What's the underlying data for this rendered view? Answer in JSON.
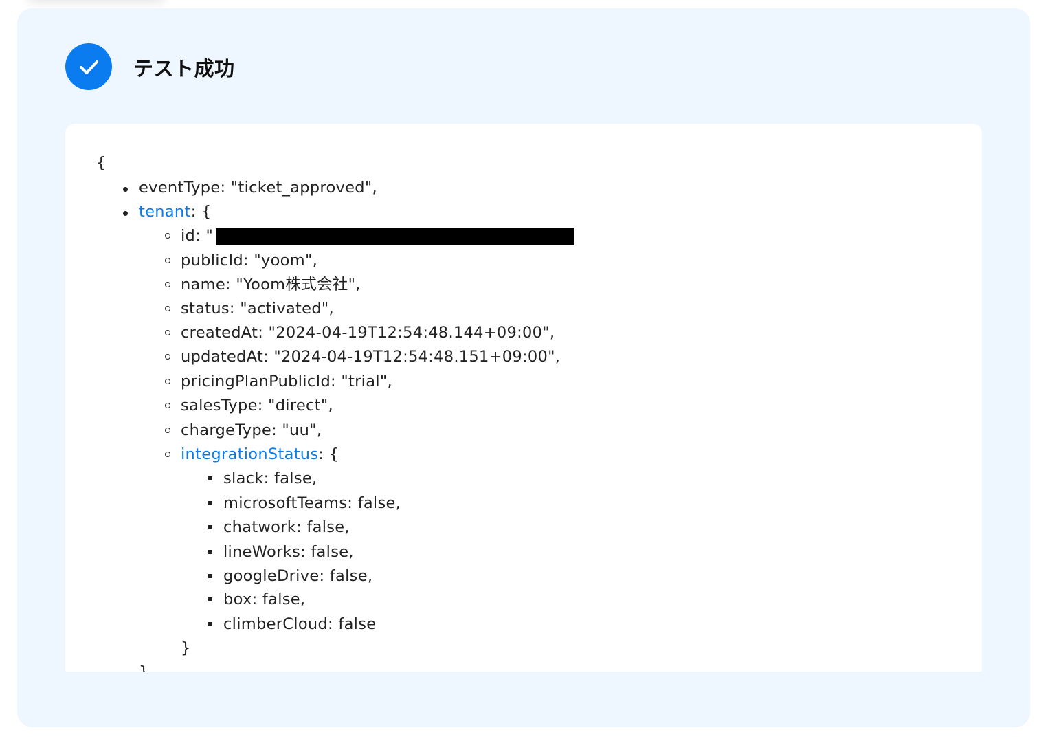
{
  "status": {
    "title": "テスト成功",
    "icon": "check-icon",
    "accent_color": "#0a7cf0"
  },
  "result": {
    "open_brace": "{",
    "event_type": {
      "key": "eventType",
      "value": ": \"ticket_approved\","
    },
    "tenant": {
      "key": "tenant",
      "open": ": {",
      "id": {
        "key": "id: \"",
        "value_redacted": true
      },
      "fields": [
        "publicId: \"yoom\",",
        "name: \"Yoom株式会社\",",
        "status: \"activated\",",
        "createdAt: \"2024-04-19T12:54:48.144+09:00\",",
        "updatedAt: \"2024-04-19T12:54:48.151+09:00\",",
        "pricingPlanPublicId: \"trial\",",
        "salesType: \"direct\",",
        "chargeType: \"uu\","
      ],
      "integration_status": {
        "key": "integrationStatus",
        "open": ": {",
        "items": [
          "slack: false,",
          "microsoftTeams: false,",
          "chatwork: false,",
          "lineWorks: false,",
          "googleDrive: false,",
          "box: false,",
          "climberCloud: false"
        ],
        "close": "}"
      },
      "close": "},"
    }
  }
}
